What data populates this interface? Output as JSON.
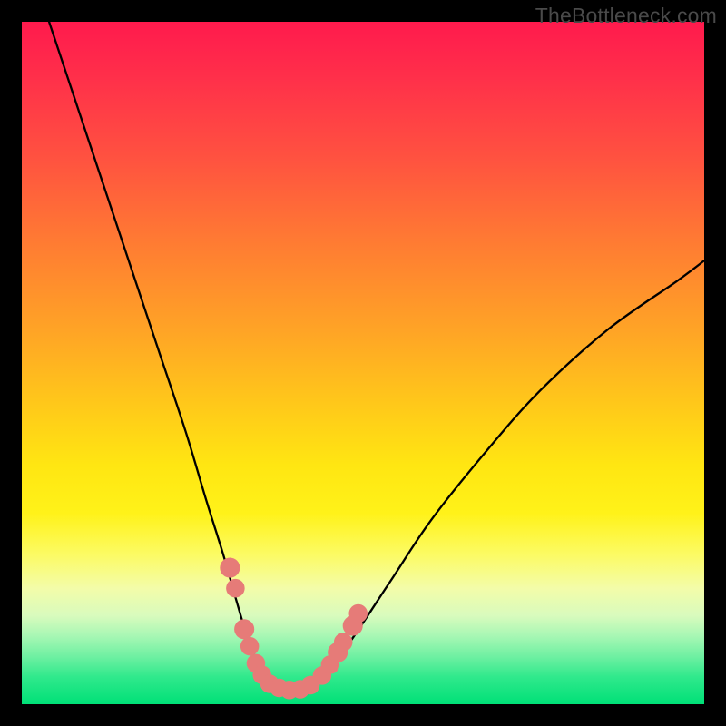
{
  "watermark": "TheBottleneck.com",
  "chart_data": {
    "type": "line",
    "title": "",
    "xlabel": "",
    "ylabel": "",
    "x_range": [
      0,
      100
    ],
    "y_range": [
      0,
      100
    ],
    "series": [
      {
        "name": "bottleneck-curve",
        "x": [
          4,
          8,
          12,
          16,
          20,
          24,
          27,
          29.5,
          31.5,
          33,
          34.5,
          36,
          38,
          40,
          42,
          44,
          48,
          54,
          60,
          68,
          76,
          86,
          96,
          100
        ],
        "y": [
          100,
          88,
          76,
          64,
          52,
          40,
          30,
          22,
          15,
          10,
          6,
          3.5,
          2,
          2,
          2.5,
          4,
          9,
          18,
          27,
          37,
          46,
          55,
          62,
          65
        ]
      }
    ],
    "markers": [
      {
        "name": "marker-left-upper",
        "x": 30.5,
        "y": 20,
        "r": 1.4
      },
      {
        "name": "marker-left-upper2",
        "x": 31.3,
        "y": 17,
        "r": 1.3
      },
      {
        "name": "marker-left-mid",
        "x": 32.6,
        "y": 11,
        "r": 1.4
      },
      {
        "name": "marker-left-mid2",
        "x": 33.4,
        "y": 8.5,
        "r": 1.3
      },
      {
        "name": "marker-left-low",
        "x": 34.3,
        "y": 6,
        "r": 1.3
      },
      {
        "name": "marker-left-low2",
        "x": 35.2,
        "y": 4.3,
        "r": 1.3
      },
      {
        "name": "marker-bottom-1",
        "x": 36.3,
        "y": 3,
        "r": 1.3
      },
      {
        "name": "marker-bottom-2",
        "x": 37.7,
        "y": 2.4,
        "r": 1.3
      },
      {
        "name": "marker-bottom-3",
        "x": 39.2,
        "y": 2.1,
        "r": 1.3
      },
      {
        "name": "marker-bottom-4",
        "x": 40.8,
        "y": 2.2,
        "r": 1.3
      },
      {
        "name": "marker-bottom-5",
        "x": 42.3,
        "y": 2.8,
        "r": 1.3
      },
      {
        "name": "marker-right-low",
        "x": 44.0,
        "y": 4.2,
        "r": 1.3
      },
      {
        "name": "marker-right-low2",
        "x": 45.2,
        "y": 5.8,
        "r": 1.3
      },
      {
        "name": "marker-right-mid",
        "x": 46.3,
        "y": 7.6,
        "r": 1.4
      },
      {
        "name": "marker-right-mid2",
        "x": 47.1,
        "y": 9.1,
        "r": 1.3
      },
      {
        "name": "marker-right-upper",
        "x": 48.5,
        "y": 11.5,
        "r": 1.4
      },
      {
        "name": "marker-right-upper2",
        "x": 49.3,
        "y": 13.3,
        "r": 1.3
      }
    ],
    "marker_color": "#e67b78",
    "curve_color": "#000000"
  }
}
